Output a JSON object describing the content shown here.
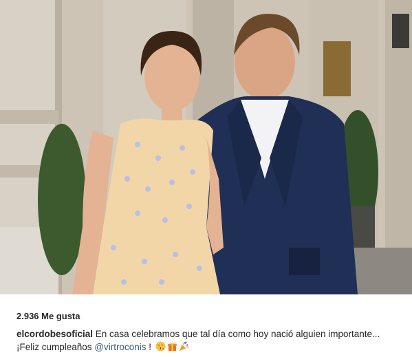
{
  "post": {
    "likes_text": "2.936 Me gusta",
    "caption": {
      "username": "elcordobesoficial",
      "text_before": " En casa celebramos que tal día como hoy nació alguien importante...¡Feliz cumpleaños ",
      "mention": "@virtroconis",
      "text_after": " ! "
    },
    "emojis": [
      "kissing-face-emoji",
      "gift-emoji",
      "party-popper-emoji"
    ]
  },
  "colors": {
    "text": "#262626",
    "mention": "#3c5a84",
    "dress": "#f2d6a8",
    "suit": "#1f2f55"
  }
}
